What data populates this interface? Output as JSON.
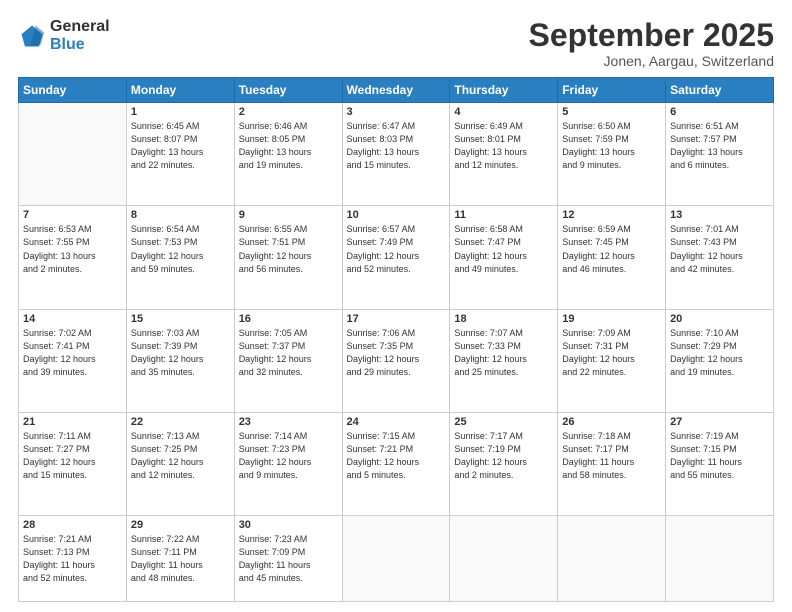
{
  "logo": {
    "line1": "General",
    "line2": "Blue"
  },
  "title": "September 2025",
  "location": "Jonen, Aargau, Switzerland",
  "days_header": [
    "Sunday",
    "Monday",
    "Tuesday",
    "Wednesday",
    "Thursday",
    "Friday",
    "Saturday"
  ],
  "weeks": [
    [
      {
        "day": "",
        "info": ""
      },
      {
        "day": "1",
        "info": "Sunrise: 6:45 AM\nSunset: 8:07 PM\nDaylight: 13 hours\nand 22 minutes."
      },
      {
        "day": "2",
        "info": "Sunrise: 6:46 AM\nSunset: 8:05 PM\nDaylight: 13 hours\nand 19 minutes."
      },
      {
        "day": "3",
        "info": "Sunrise: 6:47 AM\nSunset: 8:03 PM\nDaylight: 13 hours\nand 15 minutes."
      },
      {
        "day": "4",
        "info": "Sunrise: 6:49 AM\nSunset: 8:01 PM\nDaylight: 13 hours\nand 12 minutes."
      },
      {
        "day": "5",
        "info": "Sunrise: 6:50 AM\nSunset: 7:59 PM\nDaylight: 13 hours\nand 9 minutes."
      },
      {
        "day": "6",
        "info": "Sunrise: 6:51 AM\nSunset: 7:57 PM\nDaylight: 13 hours\nand 6 minutes."
      }
    ],
    [
      {
        "day": "7",
        "info": "Sunrise: 6:53 AM\nSunset: 7:55 PM\nDaylight: 13 hours\nand 2 minutes."
      },
      {
        "day": "8",
        "info": "Sunrise: 6:54 AM\nSunset: 7:53 PM\nDaylight: 12 hours\nand 59 minutes."
      },
      {
        "day": "9",
        "info": "Sunrise: 6:55 AM\nSunset: 7:51 PM\nDaylight: 12 hours\nand 56 minutes."
      },
      {
        "day": "10",
        "info": "Sunrise: 6:57 AM\nSunset: 7:49 PM\nDaylight: 12 hours\nand 52 minutes."
      },
      {
        "day": "11",
        "info": "Sunrise: 6:58 AM\nSunset: 7:47 PM\nDaylight: 12 hours\nand 49 minutes."
      },
      {
        "day": "12",
        "info": "Sunrise: 6:59 AM\nSunset: 7:45 PM\nDaylight: 12 hours\nand 46 minutes."
      },
      {
        "day": "13",
        "info": "Sunrise: 7:01 AM\nSunset: 7:43 PM\nDaylight: 12 hours\nand 42 minutes."
      }
    ],
    [
      {
        "day": "14",
        "info": "Sunrise: 7:02 AM\nSunset: 7:41 PM\nDaylight: 12 hours\nand 39 minutes."
      },
      {
        "day": "15",
        "info": "Sunrise: 7:03 AM\nSunset: 7:39 PM\nDaylight: 12 hours\nand 35 minutes."
      },
      {
        "day": "16",
        "info": "Sunrise: 7:05 AM\nSunset: 7:37 PM\nDaylight: 12 hours\nand 32 minutes."
      },
      {
        "day": "17",
        "info": "Sunrise: 7:06 AM\nSunset: 7:35 PM\nDaylight: 12 hours\nand 29 minutes."
      },
      {
        "day": "18",
        "info": "Sunrise: 7:07 AM\nSunset: 7:33 PM\nDaylight: 12 hours\nand 25 minutes."
      },
      {
        "day": "19",
        "info": "Sunrise: 7:09 AM\nSunset: 7:31 PM\nDaylight: 12 hours\nand 22 minutes."
      },
      {
        "day": "20",
        "info": "Sunrise: 7:10 AM\nSunset: 7:29 PM\nDaylight: 12 hours\nand 19 minutes."
      }
    ],
    [
      {
        "day": "21",
        "info": "Sunrise: 7:11 AM\nSunset: 7:27 PM\nDaylight: 12 hours\nand 15 minutes."
      },
      {
        "day": "22",
        "info": "Sunrise: 7:13 AM\nSunset: 7:25 PM\nDaylight: 12 hours\nand 12 minutes."
      },
      {
        "day": "23",
        "info": "Sunrise: 7:14 AM\nSunset: 7:23 PM\nDaylight: 12 hours\nand 9 minutes."
      },
      {
        "day": "24",
        "info": "Sunrise: 7:15 AM\nSunset: 7:21 PM\nDaylight: 12 hours\nand 5 minutes."
      },
      {
        "day": "25",
        "info": "Sunrise: 7:17 AM\nSunset: 7:19 PM\nDaylight: 12 hours\nand 2 minutes."
      },
      {
        "day": "26",
        "info": "Sunrise: 7:18 AM\nSunset: 7:17 PM\nDaylight: 11 hours\nand 58 minutes."
      },
      {
        "day": "27",
        "info": "Sunrise: 7:19 AM\nSunset: 7:15 PM\nDaylight: 11 hours\nand 55 minutes."
      }
    ],
    [
      {
        "day": "28",
        "info": "Sunrise: 7:21 AM\nSunset: 7:13 PM\nDaylight: 11 hours\nand 52 minutes."
      },
      {
        "day": "29",
        "info": "Sunrise: 7:22 AM\nSunset: 7:11 PM\nDaylight: 11 hours\nand 48 minutes."
      },
      {
        "day": "30",
        "info": "Sunrise: 7:23 AM\nSunset: 7:09 PM\nDaylight: 11 hours\nand 45 minutes."
      },
      {
        "day": "",
        "info": ""
      },
      {
        "day": "",
        "info": ""
      },
      {
        "day": "",
        "info": ""
      },
      {
        "day": "",
        "info": ""
      }
    ]
  ]
}
